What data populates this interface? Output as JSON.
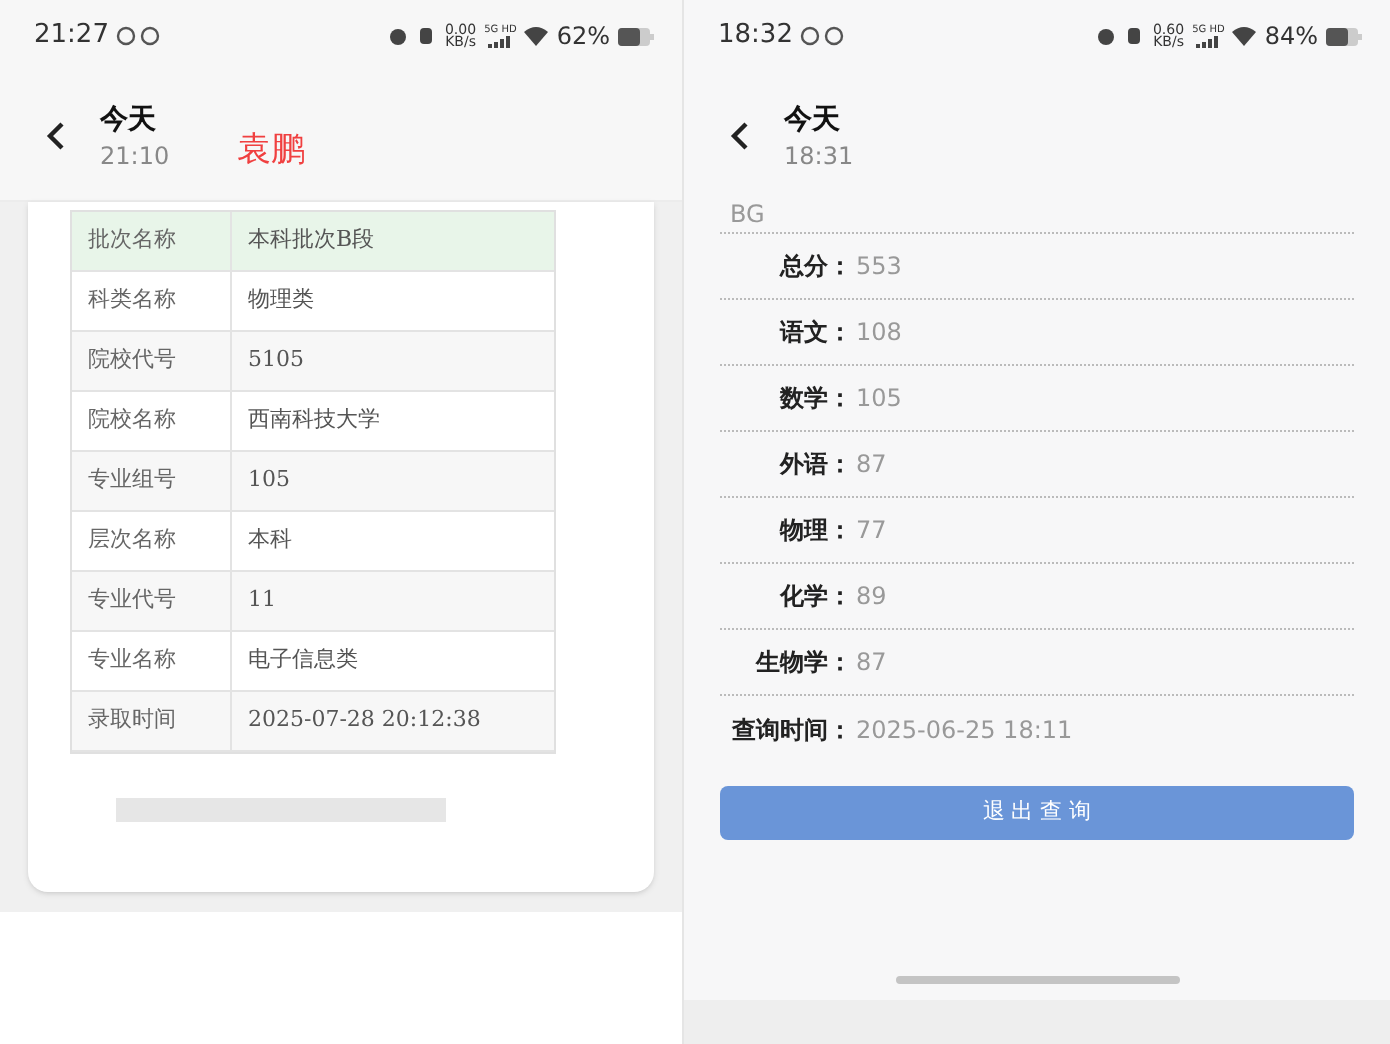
{
  "left_screen": {
    "status_bar": {
      "time": "21:27",
      "speed": "0.00",
      "speed_unit": "KB/s",
      "network": "5G HD",
      "battery": "62%"
    },
    "header": {
      "title": "今天",
      "subtime": "21:10",
      "annotation": "袁鹏"
    },
    "table": {
      "rows": [
        {
          "label": "批次名称",
          "value": "本科批次B段",
          "highlighted": true
        },
        {
          "label": "科类名称",
          "value": "物理类",
          "highlighted": false
        },
        {
          "label": "院校代号",
          "value": "5105",
          "highlighted": false
        },
        {
          "label": "院校名称",
          "value": "西南科技大学",
          "highlighted": false
        },
        {
          "label": "专业组号",
          "value": "105",
          "highlighted": false
        },
        {
          "label": "层次名称",
          "value": "本科",
          "highlighted": false
        },
        {
          "label": "专业代号",
          "value": "11",
          "highlighted": false
        },
        {
          "label": "专业名称",
          "value": "电子信息类",
          "highlighted": false
        },
        {
          "label": "录取时间",
          "value": "2025-07-28 20:12:38",
          "highlighted": false
        }
      ]
    }
  },
  "right_screen": {
    "status_bar": {
      "time": "18:32",
      "speed": "0.60",
      "speed_unit": "KB/s",
      "network": "5G HD",
      "battery": "84%"
    },
    "header": {
      "title": "今天",
      "subtime": "18:31"
    },
    "cut_text": "BG",
    "scores": [
      {
        "label": "总分：",
        "value": "553"
      },
      {
        "label": "语文：",
        "value": "108"
      },
      {
        "label": "数学：",
        "value": "105"
      },
      {
        "label": "外语：",
        "value": "87"
      },
      {
        "label": "物理：",
        "value": "77"
      },
      {
        "label": "化学：",
        "value": "89"
      },
      {
        "label": "生物学：",
        "value": "87"
      },
      {
        "label": "查询时间：",
        "value": "2025-06-25 18:11"
      }
    ],
    "button": "退 出 查 询"
  }
}
